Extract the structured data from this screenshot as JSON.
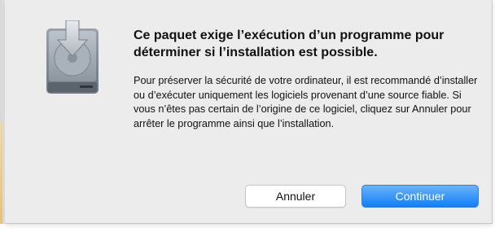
{
  "dialog": {
    "title": "Ce paquet exige l’exécution d’un programme pour déterminer si l’installation est possible.",
    "message": "Pour préserver la sécurité de votre ordinateur, il est recommandé d’installer ou d’exécuter uniquement les logiciels provenant d’une source fiable. Si vous n’êtes pas certain de l’origine de ce logiciel, cliquez sur Annuler pour arrêter le programme ainsi que l’installation.",
    "icon": "installer-disk-icon",
    "buttons": {
      "cancel_label": "Annuler",
      "continue_label": "Continuer"
    }
  },
  "colors": {
    "dialog_background": "#ececec",
    "accent_button": "#1a84f7"
  }
}
